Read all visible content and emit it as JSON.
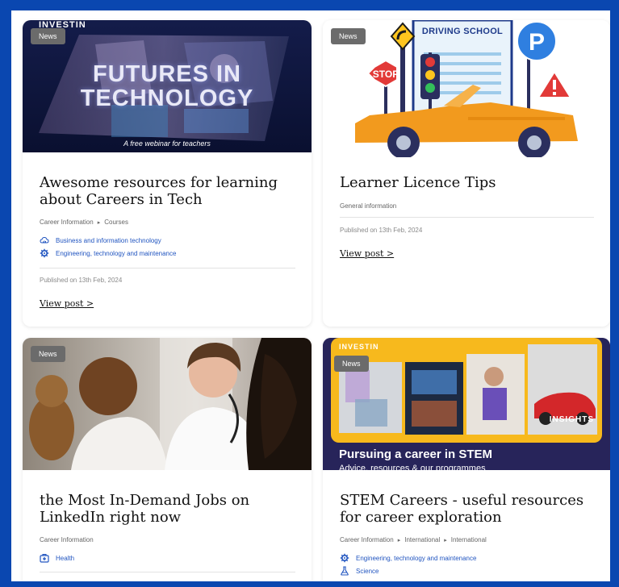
{
  "colors": {
    "border": "#0a47b0",
    "link": "#2155c0",
    "badge": "#6b6b6b"
  },
  "cards": [
    {
      "badge": "News",
      "banner": {
        "brand": "INVESTIN",
        "headline_1": "FUTURES IN",
        "headline_2": "TECHNOLOGY",
        "caption": "A free webinar for teachers"
      },
      "title": "Awesome resources for learning about Careers in Tech",
      "meta": [
        "Career Information",
        "Courses"
      ],
      "tags": [
        {
          "icon": "cloud-signal-icon",
          "label": "Business and information technology"
        },
        {
          "icon": "gear-icon",
          "label": "Engineering, technology and maintenance"
        }
      ],
      "published": "Published on 13th Feb, 2024",
      "view_post": "View post >"
    },
    {
      "badge": "News",
      "banner": {
        "sign": "DRIVING SCHOOL",
        "stop": "STOP",
        "parking": "P"
      },
      "title": "Learner Licence Tips",
      "meta": [
        "General information"
      ],
      "published": "Published on 13th Feb, 2024",
      "view_post": "View post >"
    },
    {
      "badge": "News",
      "title": "the Most In-Demand Jobs on LinkedIn right now",
      "meta": [
        "Career Information"
      ],
      "tags": [
        {
          "icon": "medical-kit-icon",
          "label": "Health"
        }
      ]
    },
    {
      "badge": "News",
      "banner": {
        "brand": "INVESTIN",
        "insights": "INSIGHTS",
        "headline": "Pursuing a career in STEM",
        "subline": "Advice, resources & our programmes"
      },
      "title": "STEM Careers - useful resources for career exploration",
      "meta": [
        "Career Information",
        "International",
        "International"
      ],
      "tags": [
        {
          "icon": "gear-icon",
          "label": "Engineering, technology and maintenance"
        },
        {
          "icon": "flask-icon",
          "label": "Science"
        }
      ]
    }
  ]
}
